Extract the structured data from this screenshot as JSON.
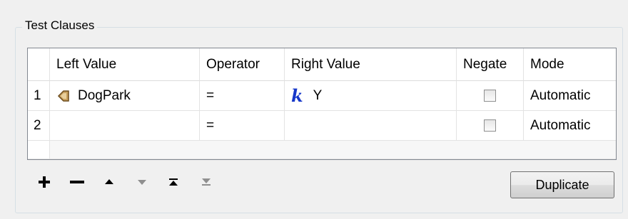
{
  "group": {
    "title": "Test Clauses"
  },
  "table": {
    "headers": [
      "Left Value",
      "Operator",
      "Right Value",
      "Negate",
      "Mode"
    ],
    "rows": [
      {
        "num": "1",
        "left": "DogPark",
        "left_icon": "feature-attribute-icon",
        "operator": "=",
        "right": "Y",
        "right_icon": "string-value-icon",
        "negate": false,
        "mode": "Automatic"
      },
      {
        "num": "2",
        "left": "",
        "operator": "=",
        "right": "",
        "negate": false,
        "mode": "Automatic"
      }
    ]
  },
  "toolbar": {
    "buttons": [
      "add-icon",
      "remove-icon",
      "move-up-icon",
      "move-down-icon",
      "move-top-icon",
      "move-bottom-icon"
    ],
    "duplicate_label": "Duplicate"
  }
}
